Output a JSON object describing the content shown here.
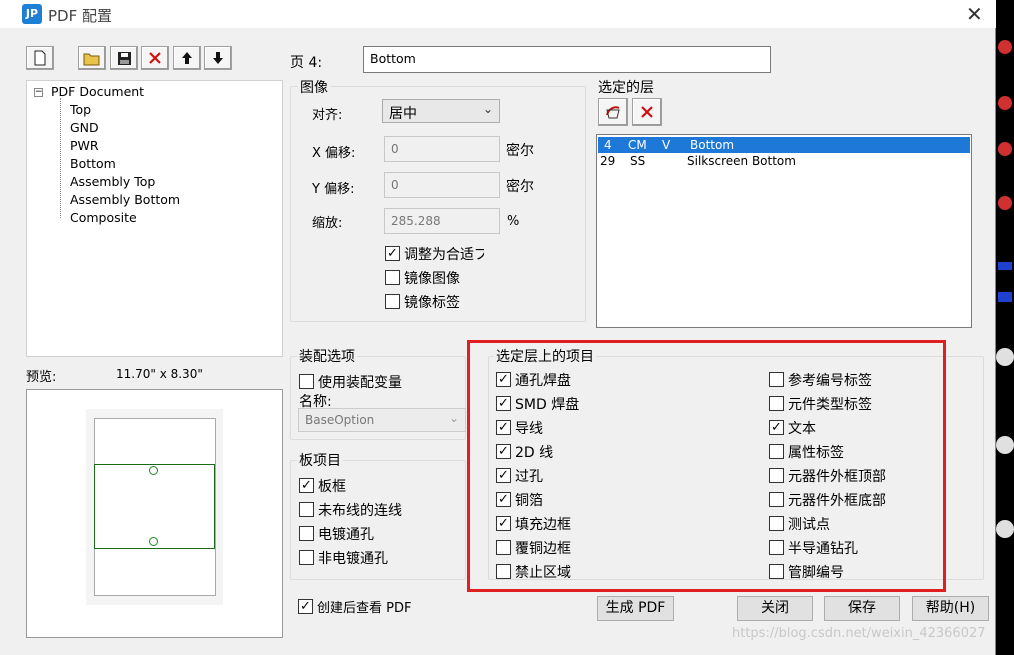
{
  "window": {
    "title": "PDF 配置",
    "icon_text": "JP"
  },
  "toolbar": [
    "new-icon",
    "open-folder-icon",
    "save-icon",
    "delete-icon",
    "move-up-icon",
    "move-down-icon"
  ],
  "tree": {
    "root": "PDF Document",
    "items": [
      "Top",
      "GND",
      "PWR",
      "Bottom",
      "Assembly Top",
      "Assembly Bottom",
      "Composite"
    ]
  },
  "page": {
    "label": "页 4:",
    "name": "Bottom"
  },
  "image_group": {
    "title": "图像",
    "align_label": "对齐:",
    "align_value": "居中",
    "x_offset_label": "X 偏移:",
    "x_offset_value": "0",
    "x_unit": "密尔",
    "y_offset_label": "Y 偏移:",
    "y_offset_value": "0",
    "y_unit": "密尔",
    "scale_label": "缩放:",
    "scale_value": "285.288",
    "scale_unit": "%",
    "fit_label": "调整为合适プ",
    "fit_checked": true,
    "mirror_image_label": "镜像图像",
    "mirror_image_checked": false,
    "mirror_label_label": "镜像标签",
    "mirror_label_checked": false
  },
  "selected_layers": {
    "title": "选定的层",
    "rows": [
      {
        "num": "4",
        "abbr": "CM",
        "flag": "V",
        "name": "Bottom",
        "selected": true
      },
      {
        "num": "29",
        "abbr": "SS",
        "flag": "",
        "name": "Silkscreen Bottom",
        "selected": false
      }
    ]
  },
  "preview": {
    "label": "预览:",
    "size": "11.70\" x 8.30\""
  },
  "assembly": {
    "title": "装配选项",
    "use_variant_label": "使用装配变量",
    "use_variant_checked": false,
    "name_label": "名称:",
    "name_value": "BaseOption"
  },
  "board_items": {
    "title": "板项目",
    "items": [
      {
        "label": "板框",
        "checked": true
      },
      {
        "label": "未布线的连线",
        "checked": false
      },
      {
        "label": "电镀通孔",
        "checked": false
      },
      {
        "label": "非电镀通孔",
        "checked": false
      }
    ]
  },
  "layer_items": {
    "title": "选定层上的项目",
    "left": [
      {
        "label": "通孔焊盘",
        "checked": true
      },
      {
        "label": "SMD 焊盘",
        "checked": true
      },
      {
        "label": "导线",
        "checked": true
      },
      {
        "label": "2D 线",
        "checked": true
      },
      {
        "label": "过孔",
        "checked": true
      },
      {
        "label": "铜箔",
        "checked": true
      },
      {
        "label": "填充边框",
        "checked": true
      },
      {
        "label": "覆铜边框",
        "checked": false
      },
      {
        "label": "禁止区域",
        "checked": false
      }
    ],
    "right": [
      {
        "label": "参考编号标签",
        "checked": false
      },
      {
        "label": "元件类型标签",
        "checked": false
      },
      {
        "label": "文本",
        "checked": true
      },
      {
        "label": "属性标签",
        "checked": false
      },
      {
        "label": "元器件外框顶部",
        "checked": false
      },
      {
        "label": "元器件外框底部",
        "checked": false
      },
      {
        "label": "测试点",
        "checked": false
      },
      {
        "label": "半导通钻孔",
        "checked": false
      },
      {
        "label": "管脚编号",
        "checked": false
      }
    ]
  },
  "footer": {
    "view_after_label": "创建后查看 PDF",
    "view_after_checked": true,
    "generate": "生成 PDF",
    "close": "关闭",
    "save": "保存",
    "help": "帮助(H)"
  },
  "watermark": "https://blog.csdn.net/weixin_42366027",
  "colors": {
    "selection": "#1e78d7",
    "highlight_frame": "#e02020",
    "delete_red": "#d01010"
  }
}
